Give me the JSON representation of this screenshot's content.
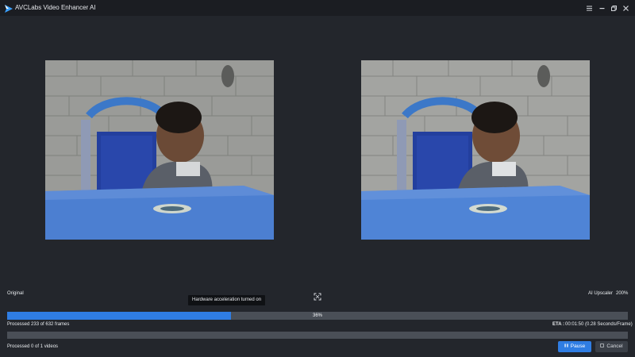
{
  "app": {
    "title": "AVCLabs Video Enhancer AI"
  },
  "window_controls": {
    "menu_icon": "menu-icon",
    "minimize_icon": "minimize-icon",
    "restore_icon": "restore-icon",
    "close_icon": "close-icon"
  },
  "preview": {
    "left_label": "Original",
    "right_label": "AI Upscaler",
    "right_scale": "200%",
    "tooltip": "Hardware acceleration turned on"
  },
  "progress": {
    "frames_percent": 36,
    "frames_percent_label": "36%",
    "frames_text": "Processed 233 of 632 frames",
    "eta_label": "ETA :",
    "eta_value": "00:01:50 (0.28 Seconds/Frame)",
    "videos_percent": 0,
    "videos_text": "Processed 0 of 1 videos"
  },
  "buttons": {
    "pause_label": "Pause",
    "cancel_label": "Cancel"
  },
  "colors": {
    "accent": "#2f7de3",
    "background": "#23262c",
    "titlebar": "#1b1d22",
    "track": "#4a4f57"
  }
}
